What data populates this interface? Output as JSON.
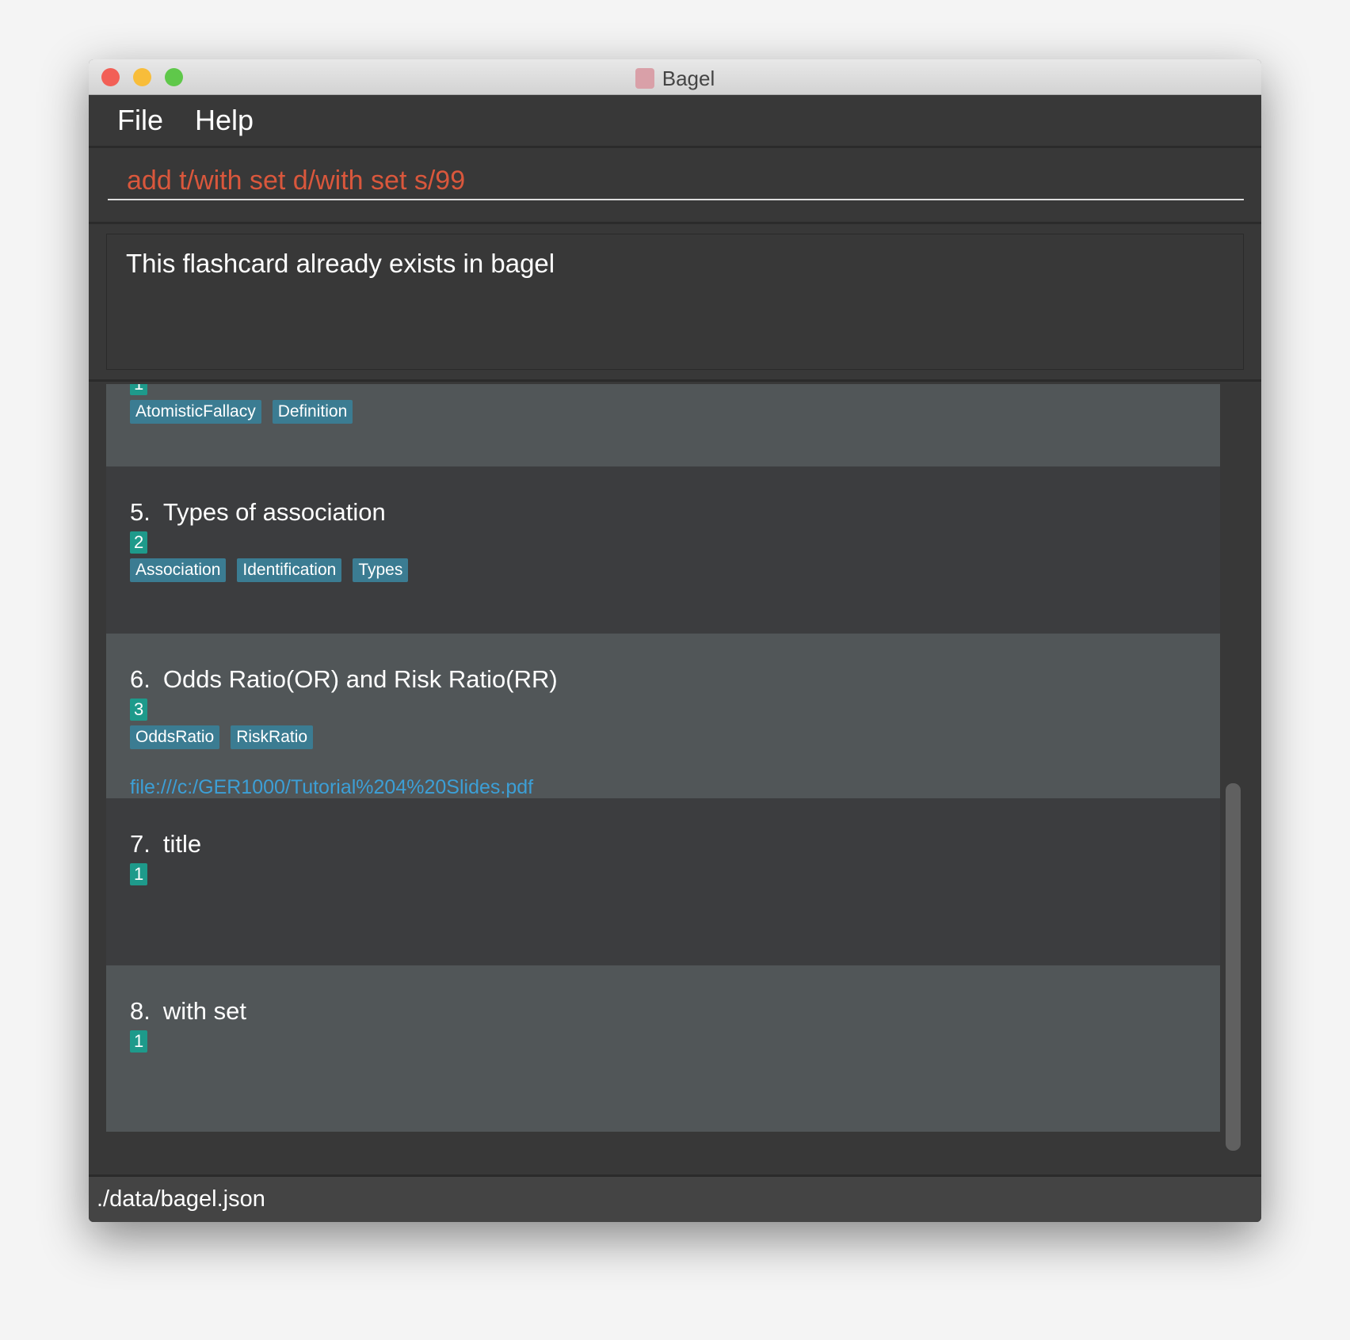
{
  "window": {
    "title": "Bagel"
  },
  "menu": [
    "File",
    "Help"
  ],
  "command": {
    "value": "add t/with set d/with set s/99"
  },
  "result": {
    "message": "This flashcard already exists in bagel"
  },
  "cards": [
    {
      "index": "",
      "title": "",
      "badge": "1",
      "tags": [
        "AtomisticFallacy",
        "Definition"
      ],
      "link": ""
    },
    {
      "index": "5.",
      "title": "Types of association",
      "badge": "2",
      "tags": [
        "Association",
        "Identification",
        "Types"
      ],
      "link": ""
    },
    {
      "index": "6.",
      "title": "Odds Ratio(OR) and Risk Ratio(RR)",
      "badge": "3",
      "tags": [
        "OddsRatio",
        "RiskRatio"
      ],
      "link": "file:///c:/GER1000/Tutorial%204%20Slides.pdf"
    },
    {
      "index": "7.",
      "title": "title",
      "badge": "1",
      "tags": [],
      "link": ""
    },
    {
      "index": "8.",
      "title": "with set",
      "badge": "1",
      "tags": [],
      "link": ""
    }
  ],
  "status": {
    "path": "./data/bagel.json"
  },
  "colors": {
    "command_text": "#d9573c",
    "tag": "#3b7c92",
    "badge": "#1e9a8b",
    "link": "#3c9fd6"
  }
}
